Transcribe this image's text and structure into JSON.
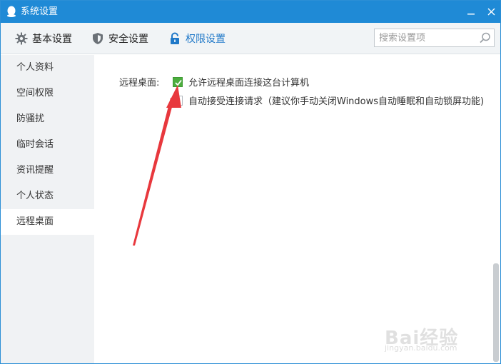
{
  "window": {
    "title": "系统设置"
  },
  "toolbar": {
    "tabs": [
      {
        "label": "基本设置",
        "icon": "gear-icon"
      },
      {
        "label": "安全设置",
        "icon": "shield-icon"
      },
      {
        "label": "权限设置",
        "icon": "lock-icon",
        "active": true
      }
    ],
    "search_placeholder": "搜索设置项"
  },
  "sidebar": {
    "items": [
      {
        "label": "个人资料"
      },
      {
        "label": "空间权限"
      },
      {
        "label": "防骚扰"
      },
      {
        "label": "临时会话"
      },
      {
        "label": "资讯提醒"
      },
      {
        "label": "个人状态"
      },
      {
        "label": "远程桌面",
        "active": true
      }
    ]
  },
  "content": {
    "section_label": "远程桌面:",
    "options": [
      {
        "label": "允许远程桌面连接这台计算机",
        "checked": true
      },
      {
        "label": "自动接受连接请求（建议你手动关闭Windows自动睡眠和自动锁屏功能)",
        "checked": false
      }
    ]
  },
  "watermark": {
    "text": "Bai经验",
    "url": "jingyan.baidu.com"
  },
  "colors": {
    "titlebar": "#1f8ad6",
    "accent": "#1f78c8",
    "checkbox_checked": "#4cae3e",
    "arrow": "#e8383d"
  }
}
